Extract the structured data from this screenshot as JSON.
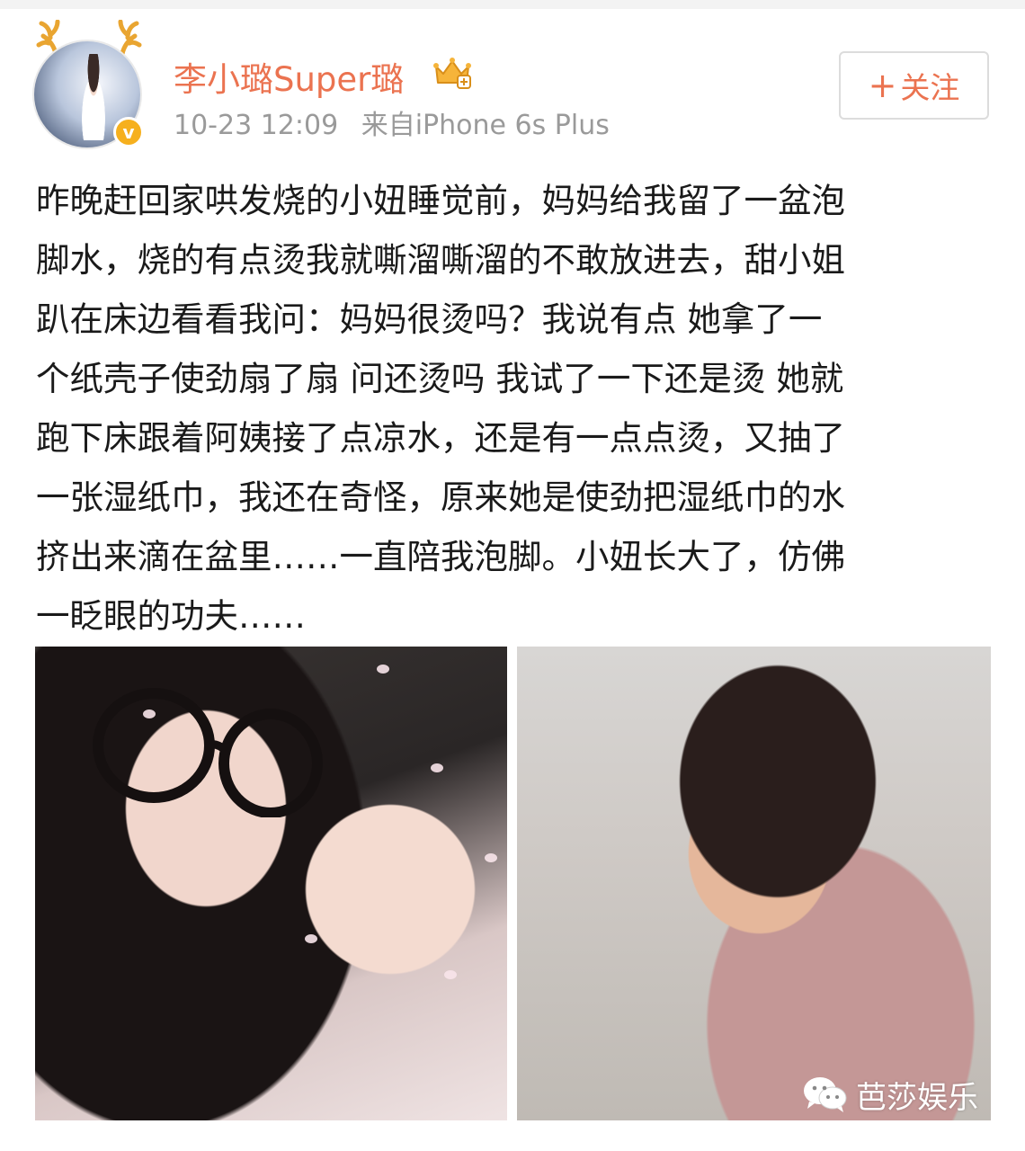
{
  "post": {
    "author": {
      "name": "李小璐Super璐",
      "avatar_icon": "avatar-reindeer-antlers",
      "verified_icon": "v-badge-icon",
      "verified_mark": "v",
      "member_icon": "crown-icon"
    },
    "timestamp": "10-23 12:09",
    "source": "来自iPhone 6s Plus",
    "follow_button": {
      "plus": "+",
      "label": "关注"
    },
    "text_lines": [
      "昨晚赶回家哄发烧的小妞睡觉前，妈妈给我留了一盆泡",
      "脚水，烧的有点烫我就嘶溜嘶溜的不敢放进去，甜小姐",
      "趴在床边看看我问：妈妈很烫吗？我说有点 她拿了一",
      "个纸壳子使劲扇了扇 问还烫吗 我试了一下还是烫 她就",
      "跑下床跟着阿姨接了点凉水，还是有一点点烫，又抽了",
      "一张湿纸巾，我还在奇怪，原来她是使劲把湿纸巾的水",
      "挤出来滴在盆里……一直陪我泡脚。小妞长大了，仿佛",
      "一眨眼的功夫……"
    ],
    "images": [
      {
        "name": "photo-mother-daughter-selfie"
      },
      {
        "name": "photo-girl-at-window"
      }
    ]
  },
  "watermark": {
    "icon": "wechat-icon",
    "text": "芭莎娱乐"
  },
  "colors": {
    "accent": "#eb7350",
    "meta": "#9a9a9a",
    "text": "#1a1a1a",
    "badge": "#f6b01e"
  }
}
